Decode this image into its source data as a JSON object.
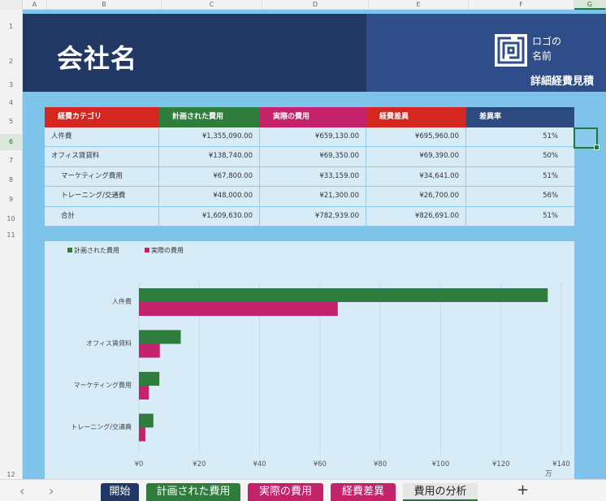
{
  "columns": [
    "A",
    "B",
    "C",
    "D",
    "E",
    "F",
    "G"
  ],
  "rows": [
    "1",
    "2",
    "3",
    "4",
    "5",
    "6",
    "7",
    "8",
    "9",
    "10",
    "11",
    "12"
  ],
  "header": {
    "company": "会社名",
    "logo_line1": "ロゴの",
    "logo_line2": "名前",
    "report_title": "詳細経費見積"
  },
  "table": {
    "headers": [
      "経費カテゴリ",
      "計画された費用",
      "実際の費用",
      "経費差異",
      "差異率"
    ],
    "rows": [
      [
        "人件費",
        "¥1,355,090.00",
        "¥659,130.00",
        "¥695,960.00",
        "51%"
      ],
      [
        "オフィス賃貸料",
        "¥138,740.00",
        "¥69,350.00",
        "¥69,390.00",
        "50%"
      ],
      [
        "マーケティング費用",
        "¥67,800.00",
        "¥33,159.00",
        "¥34,641.00",
        "51%"
      ],
      [
        "トレーニング/交通費",
        "¥48,000.00",
        "¥21,300.00",
        "¥26,700.00",
        "56%"
      ],
      [
        "合計",
        "¥1,609,630.00",
        "¥782,939.00",
        "¥826,691.00",
        "51%"
      ]
    ]
  },
  "chart_data": {
    "type": "bar",
    "orientation": "horizontal",
    "categories": [
      "人件費",
      "オフィス賃貸料",
      "マーケティング費用",
      "トレーニング/交通費"
    ],
    "series": [
      {
        "name": "計画された費用",
        "values": [
          135.509,
          13.874,
          6.78,
          4.8
        ],
        "color": "#2e7d3d"
      },
      {
        "name": "実際の費用",
        "values": [
          65.913,
          6.935,
          3.3159,
          2.13
        ],
        "color": "#c4226a"
      }
    ],
    "xticks": [
      "¥0",
      "¥20",
      "¥40",
      "¥60",
      "¥80",
      "¥100",
      "¥120",
      "¥140"
    ],
    "xlim": [
      0,
      140
    ],
    "unit_label": "万",
    "legend_position": "top-left",
    "grid": true
  },
  "tabs": [
    "開始",
    "計画された費用",
    "実際の費用",
    "経費差異",
    "費用の分析"
  ],
  "add_tab": "+",
  "nav": {
    "prev": "‹",
    "next": "›"
  },
  "colors": {
    "navy": "#223864",
    "blue": "#2e4d89",
    "red": "#d3271f",
    "green": "#2e7d3d",
    "magenta": "#c4226a",
    "sheet_bg": "#7ec4ea",
    "panel_bg": "#d8ecf8"
  }
}
